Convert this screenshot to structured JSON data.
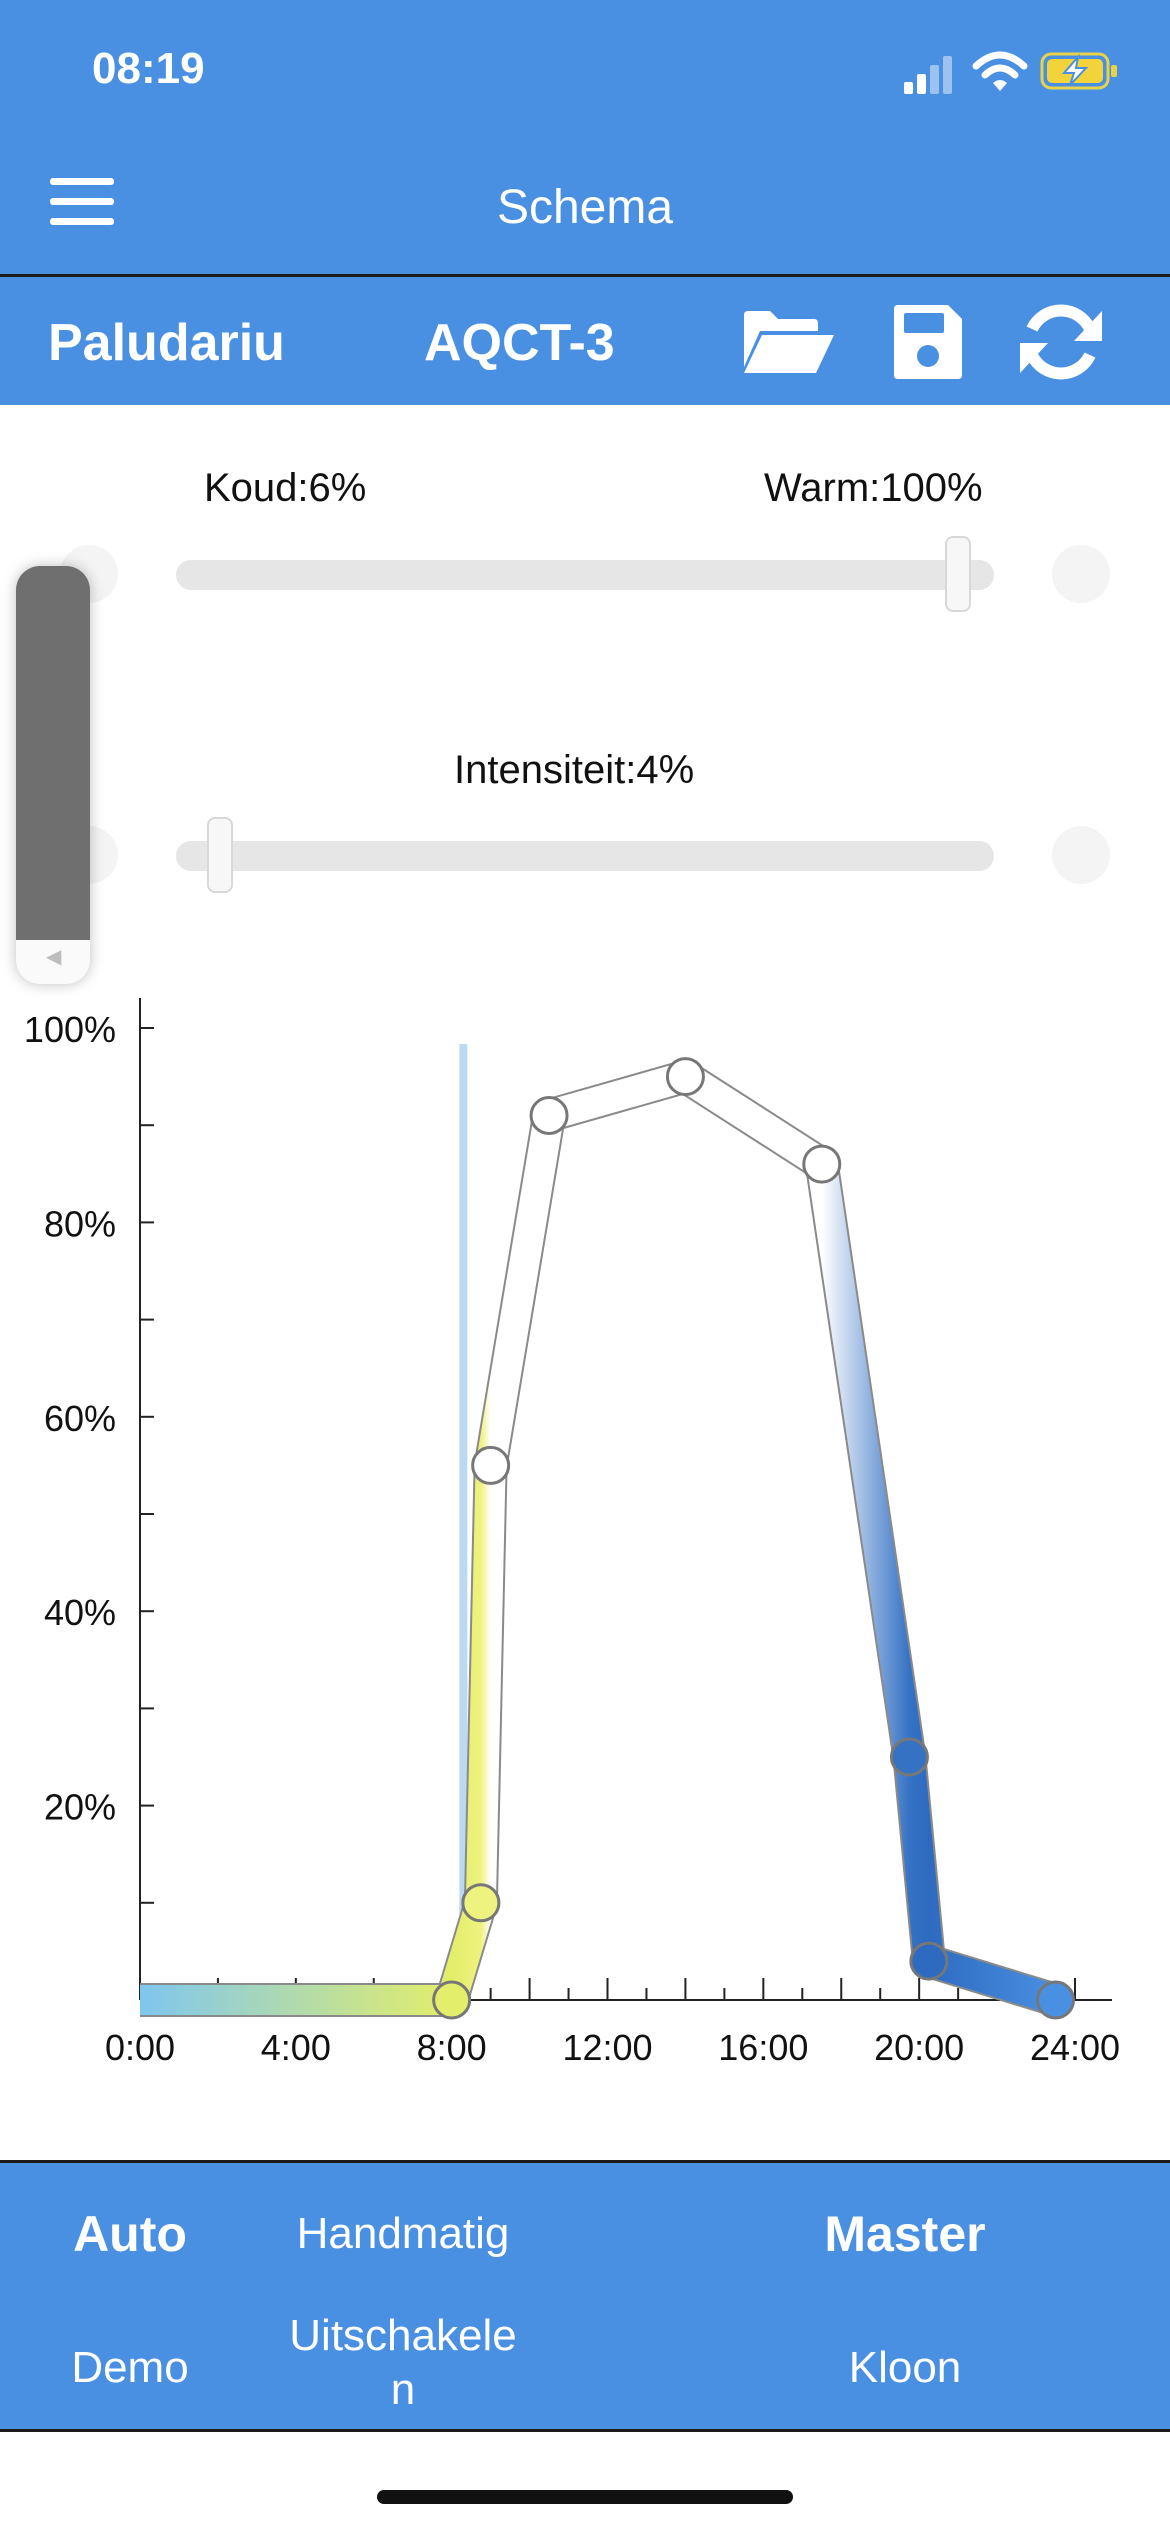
{
  "status_bar": {
    "time": "08:19"
  },
  "nav": {
    "title": "Schema",
    "menu_icon": "hamburger-menu-icon"
  },
  "device_bar": {
    "group": "Paludariu",
    "device": "AQCT-3",
    "icons": [
      "folder-open-icon",
      "save-icon",
      "refresh-icon"
    ]
  },
  "sliders": {
    "color": {
      "left_label": "Koud:6%",
      "right_label": "Warm:100%",
      "warm_percent": 100
    },
    "intensity": {
      "label": "Intensiteit:4%",
      "percent": 4
    }
  },
  "volume_hud": {
    "level": 0.9
  },
  "chart_data": {
    "type": "line",
    "title": "",
    "xlabel": "",
    "ylabel": "",
    "x_ticks": [
      "0:00",
      "4:00",
      "8:00",
      "12:00",
      "16:00",
      "20:00",
      "24:00"
    ],
    "y_ticks": [
      "20%",
      "40%",
      "60%",
      "80%",
      "100%"
    ],
    "xlim": [
      0,
      24
    ],
    "ylim": [
      0,
      100
    ],
    "current_time_hours": 8.3,
    "points": [
      {
        "x": 0,
        "y": 0,
        "color": "#7fc6ef"
      },
      {
        "x": 8.0,
        "y": 0,
        "color": "#e3ee6a"
      },
      {
        "x": 8.75,
        "y": 10,
        "color": "#eef27e"
      },
      {
        "x": 9.0,
        "y": 55,
        "color": "#ffffff"
      },
      {
        "x": 10.5,
        "y": 91,
        "color": "#ffffff"
      },
      {
        "x": 14.0,
        "y": 95,
        "color": "#ffffff"
      },
      {
        "x": 17.5,
        "y": 86,
        "color": "#ffffff"
      },
      {
        "x": 19.75,
        "y": 25,
        "color": "#3572c4"
      },
      {
        "x": 20.25,
        "y": 4,
        "color": "#2e6bc0"
      },
      {
        "x": 23.5,
        "y": 0,
        "color": "#4a90e2"
      }
    ]
  },
  "tabs": {
    "auto": "Auto",
    "handmatig": "Handmatig",
    "master": "Master",
    "demo": "Demo",
    "uitschakelen": "Uitschakele\nn",
    "kloon": "Kloon"
  }
}
